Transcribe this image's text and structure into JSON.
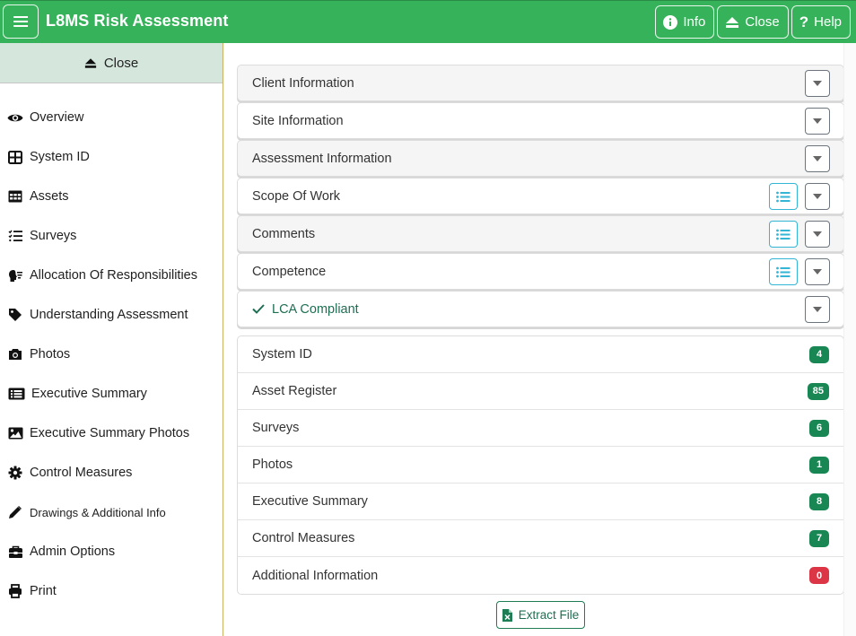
{
  "header": {
    "title": "L8MS Risk Assessment",
    "menu_icon": "hamburger-icon",
    "buttons": [
      {
        "label": "Info",
        "icon": "info-circle-icon"
      },
      {
        "label": "Close",
        "icon": "eject-icon"
      },
      {
        "label": "Help",
        "icon": "question-icon"
      }
    ]
  },
  "sidebar": {
    "close_label": "Close",
    "items": [
      {
        "label": "Overview",
        "icon": "eye-icon"
      },
      {
        "label": "System ID",
        "icon": "grid-icon"
      },
      {
        "label": "Assets",
        "icon": "table-icon"
      },
      {
        "label": "Surveys",
        "icon": "checklist-icon"
      },
      {
        "label": "Allocation Of Responsibilities",
        "icon": "head-list-icon"
      },
      {
        "label": "Understanding Assessment",
        "icon": "tag-icon"
      },
      {
        "label": "Photos",
        "icon": "camera-icon"
      },
      {
        "label": "Executive Summary",
        "icon": "list-alt-icon"
      },
      {
        "label": "Executive Summary Photos",
        "icon": "image-icon"
      },
      {
        "label": "Control Measures",
        "icon": "cog-icon"
      },
      {
        "label": "Drawings & Additional Info",
        "icon": "pencil-icon"
      },
      {
        "label": "Admin Options",
        "icon": "toolbox-icon"
      },
      {
        "label": "Print",
        "icon": "print-icon"
      }
    ]
  },
  "sections": [
    {
      "label": "Client Information",
      "has_list": false
    },
    {
      "label": "Site Information",
      "has_list": false
    },
    {
      "label": "Assessment Information",
      "has_list": false
    },
    {
      "label": "Scope Of Work",
      "has_list": true
    },
    {
      "label": "Comments",
      "has_list": true
    },
    {
      "label": "Competence",
      "has_list": true
    },
    {
      "label": "LCA Compliant",
      "has_list": false,
      "checked": true
    }
  ],
  "summary": [
    {
      "label": "System ID",
      "count": "4",
      "status": "success"
    },
    {
      "label": "Asset Register",
      "count": "85",
      "status": "success"
    },
    {
      "label": "Surveys",
      "count": "6",
      "status": "success"
    },
    {
      "label": "Photos",
      "count": "1",
      "status": "success"
    },
    {
      "label": "Executive Summary",
      "count": "8",
      "status": "success"
    },
    {
      "label": "Control Measures",
      "count": "7",
      "status": "success"
    },
    {
      "label": "Additional Information",
      "count": "0",
      "status": "danger"
    }
  ],
  "extract_label": "Extract File",
  "colors": {
    "brand": "#36b25a",
    "badge_success": "#198754",
    "badge_danger": "#dc3545",
    "accent_info": "#33b5d6",
    "compliant_text": "#1e6f52"
  }
}
